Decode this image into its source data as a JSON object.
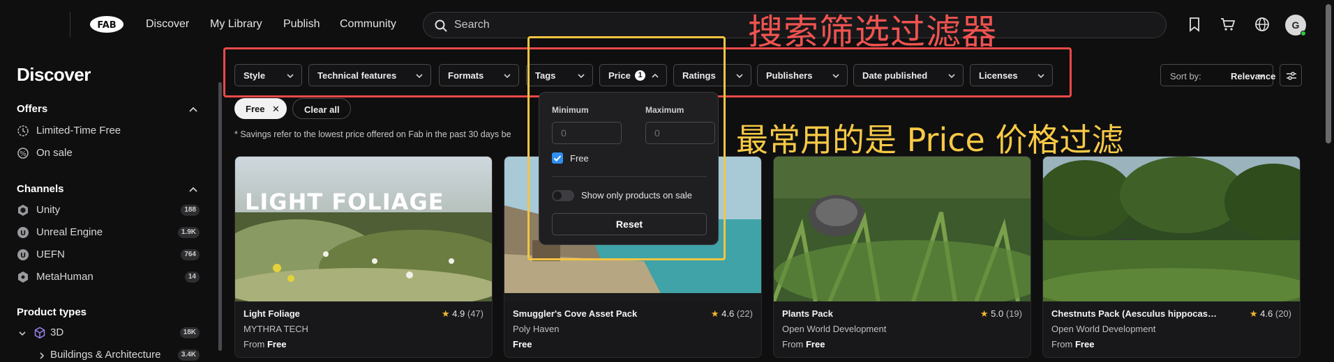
{
  "nav": {
    "logo_text": "FAB",
    "links": [
      "Discover",
      "My Library",
      "Publish",
      "Community"
    ],
    "search_placeholder": "Search",
    "avatar_initial": "G"
  },
  "overlay": {
    "title": "搜索筛选过滤器",
    "note": "最常用的是 Price 价格过滤"
  },
  "sidebar": {
    "title": "Discover",
    "offers_title": "Offers",
    "offers": [
      {
        "label": "Limited-Time Free",
        "icon": "clock-icon"
      },
      {
        "label": "On sale",
        "icon": "sale-tag-icon"
      }
    ],
    "channels_title": "Channels",
    "channels": [
      {
        "label": "Unity",
        "count": "188",
        "icon": "unity-icon"
      },
      {
        "label": "Unreal Engine",
        "count": "1.9K",
        "icon": "unreal-icon"
      },
      {
        "label": "UEFN",
        "count": "764",
        "icon": "uefn-icon"
      },
      {
        "label": "MetaHuman",
        "count": "14",
        "icon": "metahuman-icon"
      }
    ],
    "product_types_title": "Product types",
    "product_types": [
      {
        "label": "3D",
        "count": "18K",
        "icon": "cube-icon"
      },
      {
        "label": "Buildings & Architecture",
        "count": "3.4K",
        "icon": "chevron-right-icon"
      }
    ]
  },
  "filters": {
    "chips": [
      "Style",
      "Technical features",
      "Formats",
      "Tags",
      "Price",
      "Ratings",
      "Publishers",
      "Date published",
      "Licenses"
    ],
    "price_count": "1",
    "sort_label": "Sort by:",
    "sort_value": "Relevance",
    "active_pill": "Free",
    "clear_all": "Clear all",
    "savings_note": "* Savings refer to the lowest price offered on Fab in the past 30 days be"
  },
  "price_popover": {
    "min_label": "Minimum",
    "max_label": "Maximum",
    "min_placeholder": "0",
    "max_placeholder": "0",
    "free_label": "Free",
    "free_checked": true,
    "sale_toggle_label": "Show only products on sale",
    "sale_toggle_on": false,
    "reset_label": "Reset"
  },
  "cards": [
    {
      "name": "Light Foliage",
      "rating": "4.9",
      "reviews": "(47)",
      "publisher": "MYTHRA TECH",
      "price_prefix": "From",
      "price": "Free",
      "thumb_title": "LIGHT FOLIAGE"
    },
    {
      "name": "Smuggler's Cove Asset Pack",
      "rating": "4.6",
      "reviews": "(22)",
      "publisher": "Poly Haven",
      "price_prefix": "",
      "price": "Free",
      "thumb_title": ""
    },
    {
      "name": "Plants Pack",
      "rating": "5.0",
      "reviews": "(19)",
      "publisher": "Open World Development",
      "price_prefix": "From",
      "price": "Free",
      "thumb_title": ""
    },
    {
      "name": "Chestnuts Pack (Aesculus hippocastan...",
      "rating": "4.6",
      "reviews": "(20)",
      "publisher": "Open World Development",
      "price_prefix": "From",
      "price": "Free",
      "thumb_title": ""
    }
  ],
  "colors": {
    "background": "#0f0f10",
    "annotation_red": "#ea4a48",
    "annotation_yellow": "#f4c542",
    "accent_blue": "#2f8ff0",
    "star": "#f5b82e"
  }
}
